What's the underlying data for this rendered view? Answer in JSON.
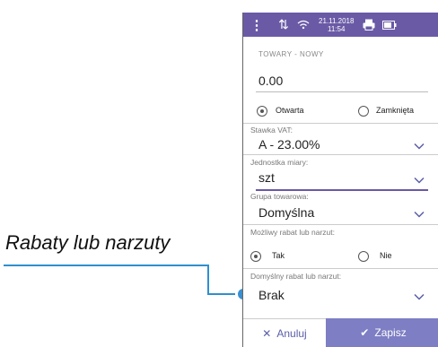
{
  "callout": {
    "label": "Rabaty lub narzuty"
  },
  "status_bar": {
    "menu_icon": "more-vertical-icon",
    "signal_icon": "data-transfer-icon",
    "wifi_icon": "wifi-icon",
    "date": "21.11.2018",
    "time": "11:54",
    "printer_icon": "printer-icon",
    "battery_icon": "battery-icon",
    "color": "#6a5aa6"
  },
  "form": {
    "title": "TOWARY - NOWY",
    "price": "0.00",
    "price_type": {
      "options": [
        {
          "label": "Otwarta",
          "selected": true
        },
        {
          "label": "Zamknięta",
          "selected": false
        }
      ]
    },
    "vat": {
      "label": "Stawka VAT:",
      "value": "A - 23.00%"
    },
    "unit": {
      "label": "Jednostka miary:",
      "value": "szt"
    },
    "group": {
      "label": "Grupa towarowa:",
      "value": "Domyślna"
    },
    "discount_possible": {
      "label": "Możliwy rabat lub narzut:",
      "options": [
        {
          "label": "Tak",
          "selected": true
        },
        {
          "label": "Nie",
          "selected": false
        }
      ]
    },
    "default_discount": {
      "label": "Domyślny rabat lub narzut:",
      "value": "Brak"
    }
  },
  "footer": {
    "cancel_label": "Anuluj",
    "save_label": "Zapisz",
    "accent": "#7d7ec4"
  }
}
